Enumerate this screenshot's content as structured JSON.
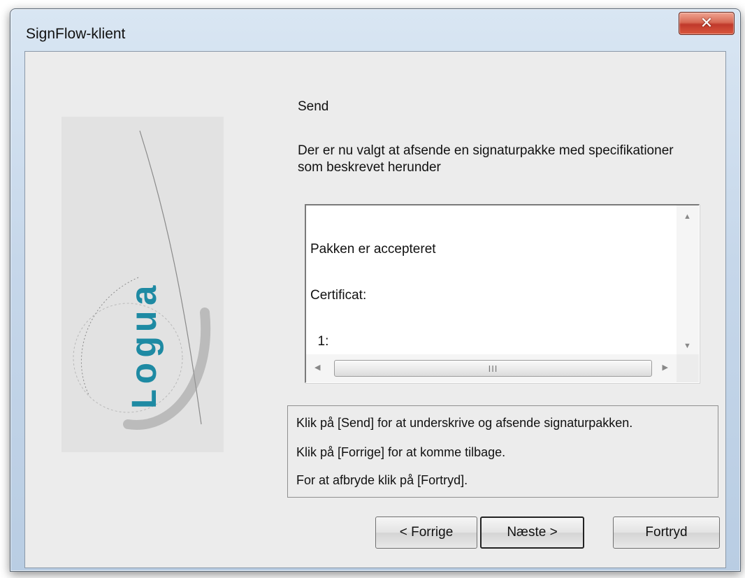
{
  "window": {
    "title": "SignFlow-klient",
    "close_glyph": "✕"
  },
  "logo": {
    "text": "Logua",
    "accent_color": "#1e8aa3"
  },
  "page": {
    "heading": "Send",
    "intro": "Der er nu valgt at afsende en signaturpakke med specifikationer som beskrevet herunder"
  },
  "details": {
    "lines": [
      "Pakken er accepteret",
      "Certificat:",
      "  1:"
    ],
    "scroll_thumb_grip": "III"
  },
  "instructions": [
    "Klik på [Send] for at underskrive og afsende signaturpakken.",
    "Klik på [Forrige] for at komme tilbage.",
    "For at afbryde klik på [Fortryd]."
  ],
  "buttons": {
    "back": "< Forrige",
    "next": "Næste >",
    "cancel": "Fortryd"
  }
}
